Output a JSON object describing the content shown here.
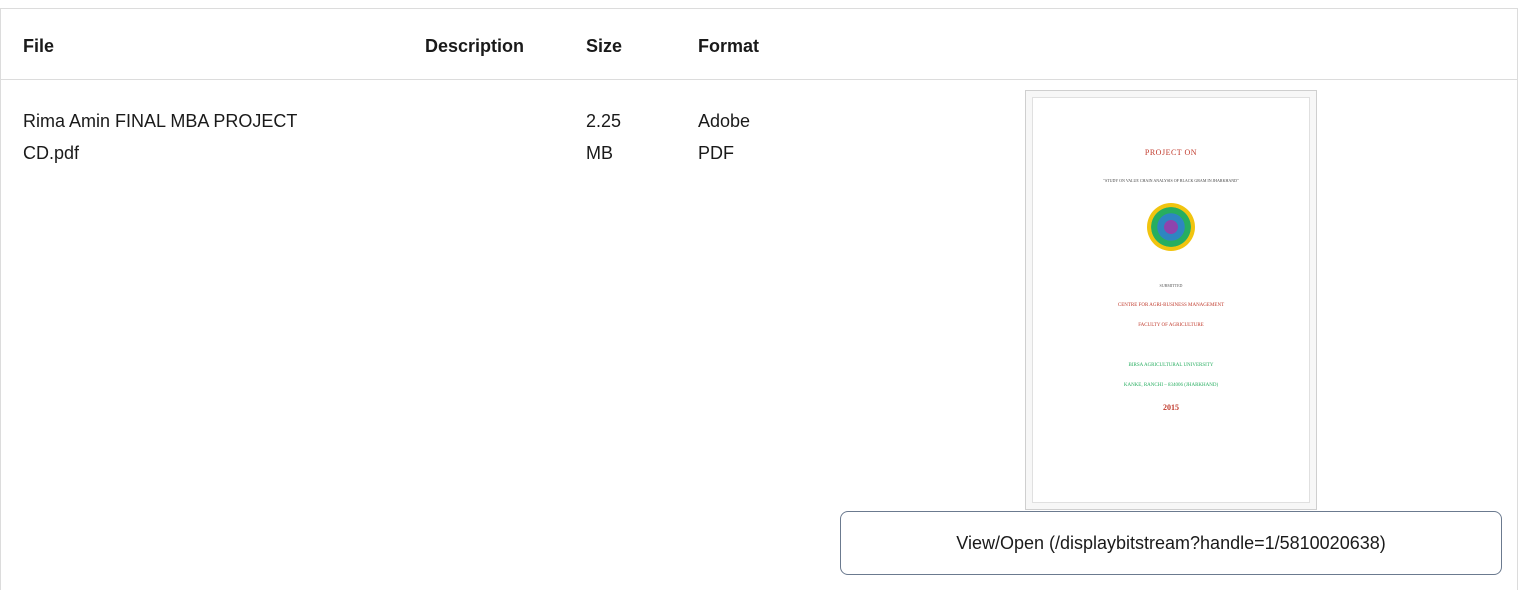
{
  "table": {
    "headers": {
      "file": "File",
      "description": "Description",
      "size": "Size",
      "format": "Format"
    },
    "rows": [
      {
        "file_line1": "Rima Amin FINAL MBA PROJECT",
        "file_line2": "CD.pdf",
        "description": "",
        "size_line1": "2.25",
        "size_line2": "MB",
        "format_line1": "Adobe",
        "format_line2": "PDF",
        "thumbnail": {
          "title": "PROJECT ON",
          "subtitle": "\"STUDY ON VALUE CHAIN ANALYSIS OF BLACK GRAM IN JHARKHAND\"",
          "submitted": "SUBMITTED",
          "centre": "CENTRE FOR AGRI-BUSINESS MANAGEMENT",
          "faculty": "FACULTY OF AGRICULTURE",
          "university": "BIRSA AGRICULTURAL UNIVERSITY",
          "place": "KANKE, RANCHI – 834006 (JHARKHAND)",
          "year": "2015"
        },
        "view_open": "View/Open (/displaybitstream?handle=1/5810020638)"
      }
    ]
  }
}
